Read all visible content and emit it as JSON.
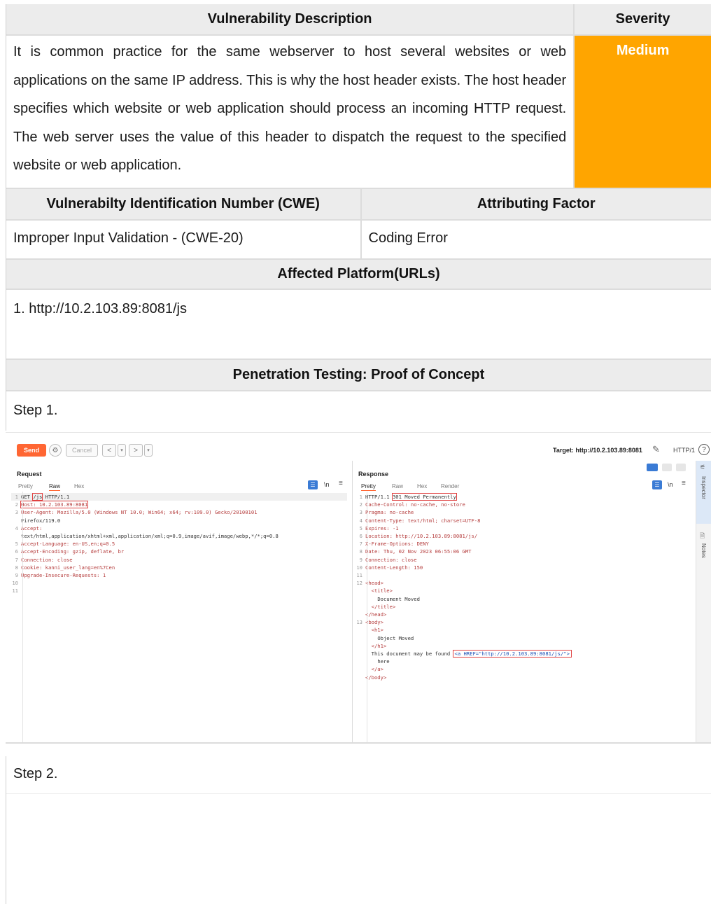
{
  "table": {
    "desc_header": "Vulnerability Description",
    "severity_header": "Severity",
    "severity_value": "Medium",
    "severity_color": "#FFA500",
    "description": "It is common practice for the same webserver to host several websites or web applications on the same IP address. This is why the host header exists. The host header specifies which website or web application should process an incoming HTTP request. The web server uses the value of this header to dispatch the request to the specified website or web application.",
    "cwe_header": "Vulnerabilty Identification Number (CWE)",
    "factor_header": "Attributing Factor",
    "cwe_value": "Improper Input Validation - (CWE-20)",
    "factor_value": "Coding Error",
    "affected_header": "Affected Platform(URLs)",
    "affected_url": "1. http://10.2.103.89:8081/js",
    "poc_header": "Penetration Testing: Proof of Concept",
    "step1": "Step 1.",
    "step2": "Step 2."
  },
  "burp": {
    "send_label": "Send",
    "cancel_label": "Cancel",
    "target_label": "Target: http://10.2.103.89:8081",
    "protocol_label": "HTTP/1",
    "request_title": "Request",
    "response_title": "Response",
    "request_tabs": [
      "Pretty",
      "Raw",
      "Hex"
    ],
    "response_tabs": [
      "Pretty",
      "Raw",
      "Hex",
      "Render"
    ],
    "newline_label": "\\n",
    "inspector_label": "Inspector",
    "notes_label": "Notes",
    "request_lines": {
      "l1_method": "GET",
      "l1_path": "/js",
      "l1_proto": "HTTP/1.1",
      "l2": "Host: 10.2.103.89:8081",
      "l3": "User-Agent: Mozilla/5.0 (Windows NT 10.0; Win64; x64; rv:109.0) Gecko/20100101",
      "l3b": "Firefox/119.0",
      "l4": "Accept:",
      "l4b": "text/html,application/xhtml+xml,application/xml;q=0.9,image/avif,image/webp,*/*;q=0.8",
      "l5": "Accept-Language: en-US,en;q=0.5",
      "l6": "Accept-Encoding: gzip, deflate, br",
      "l7": "Connection: close",
      "l8": "Cookie: kanni_user_lang=en%7Cen",
      "l9": "Upgrade-Insecure-Requests: 1"
    },
    "response_lines": {
      "l1_proto": "HTTP/1.1",
      "l1_status": "301 Moved Permanently",
      "l2": "Cache-Control: no-cache, no-store",
      "l3": "Pragma: no-cache",
      "l4": "Content-Type: text/html; charset=UTF-8",
      "l5": "Expires: -1",
      "l6": "Location: http://10.2.103.89:8081/js/",
      "l7": "X-Frame-Options: DENY",
      "l8": "Date: Thu, 02 Nov 2023 06:55:06 GMT",
      "l9": "Connection: close",
      "l10": "Content-Length: 150",
      "h_head_open": "<head>",
      "h_title_open": "<title>",
      "h_title_text": "Document Moved",
      "h_title_close": "</title>",
      "h_head_close": "</head>",
      "h_body_open": "<body>",
      "h_h1_open": "<h1>",
      "h_h1_text": "Object Moved",
      "h_h1_close": "</h1>",
      "h_found": "This document may be found",
      "h_href": "<a HREF=\"http://10.2.103.89:8081/js/\">",
      "h_here": "here",
      "h_a_close": "</a>",
      "h_body_close": "</body>"
    }
  }
}
